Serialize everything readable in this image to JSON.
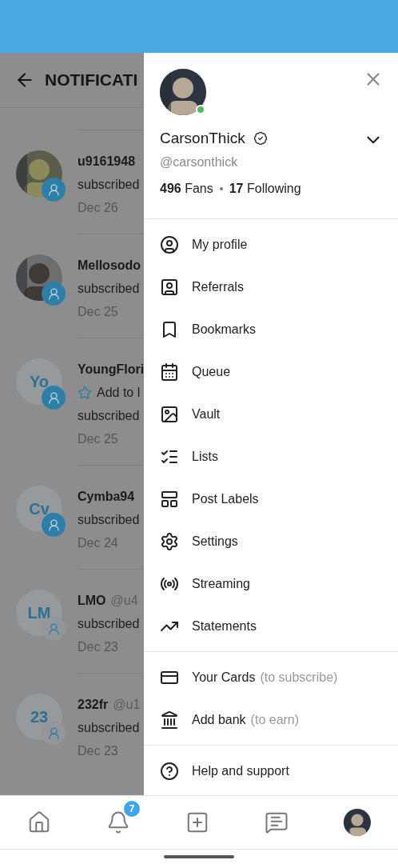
{
  "notifications": {
    "title": "NOTIFICATI",
    "items": [
      {
        "avatar": {
          "kind": "picture"
        },
        "name": "u9161948",
        "lines": [
          "subscribed"
        ],
        "date": "Dec 26",
        "badge_filled": true
      },
      {
        "avatar": {
          "kind": "picture"
        },
        "name": "Mellosodo",
        "lines": [
          "subscribed"
        ],
        "date": "Dec 25",
        "badge_filled": true
      },
      {
        "avatar": {
          "kind": "initials",
          "text": "Yo"
        },
        "name": "YoungFlori",
        "action": "Add to l",
        "lines": [
          "subscribed"
        ],
        "date": "Dec 25",
        "badge_filled": true
      },
      {
        "avatar": {
          "kind": "initials",
          "text": "Cv"
        },
        "name": "Cymba94",
        "lines": [
          "subscribed"
        ],
        "date": "Dec 24",
        "badge_filled": true
      },
      {
        "avatar": {
          "kind": "initials",
          "text": "LM"
        },
        "name": "LMO",
        "handle": "@u4",
        "lines": [
          "subscribed"
        ],
        "date": "Dec 23",
        "badge_filled": false
      },
      {
        "avatar": {
          "kind": "initials",
          "text": "23"
        },
        "name": "232fr",
        "handle": "@u1",
        "lines": [
          "subscribed"
        ],
        "date": "Dec 23",
        "badge_filled": false
      }
    ]
  },
  "drawer": {
    "online": true,
    "name": "CarsonThick",
    "verified": true,
    "handle": "@carsonthick",
    "stats": [
      {
        "count": "496",
        "label": "Fans"
      },
      {
        "count": "17",
        "label": "Following"
      }
    ],
    "groups": [
      [
        {
          "label": "My profile"
        },
        {
          "label": "Referrals"
        },
        {
          "label": "Bookmarks"
        },
        {
          "label": "Queue"
        },
        {
          "label": "Vault"
        },
        {
          "label": "Lists"
        },
        {
          "label": "Post Labels"
        },
        {
          "label": "Settings"
        },
        {
          "label": "Streaming"
        },
        {
          "label": "Statements"
        }
      ],
      [
        {
          "label": "Your Cards",
          "note": "(to subscribe)"
        },
        {
          "label": "Add bank",
          "note": "(to earn)"
        }
      ],
      [
        {
          "label": "Help and support"
        }
      ]
    ]
  },
  "bottom_nav": [
    {
      "kind": "icon"
    },
    {
      "kind": "icon",
      "badge": "7"
    },
    {
      "kind": "icon"
    },
    {
      "kind": "icon"
    },
    {
      "kind": "avatar"
    }
  ]
}
